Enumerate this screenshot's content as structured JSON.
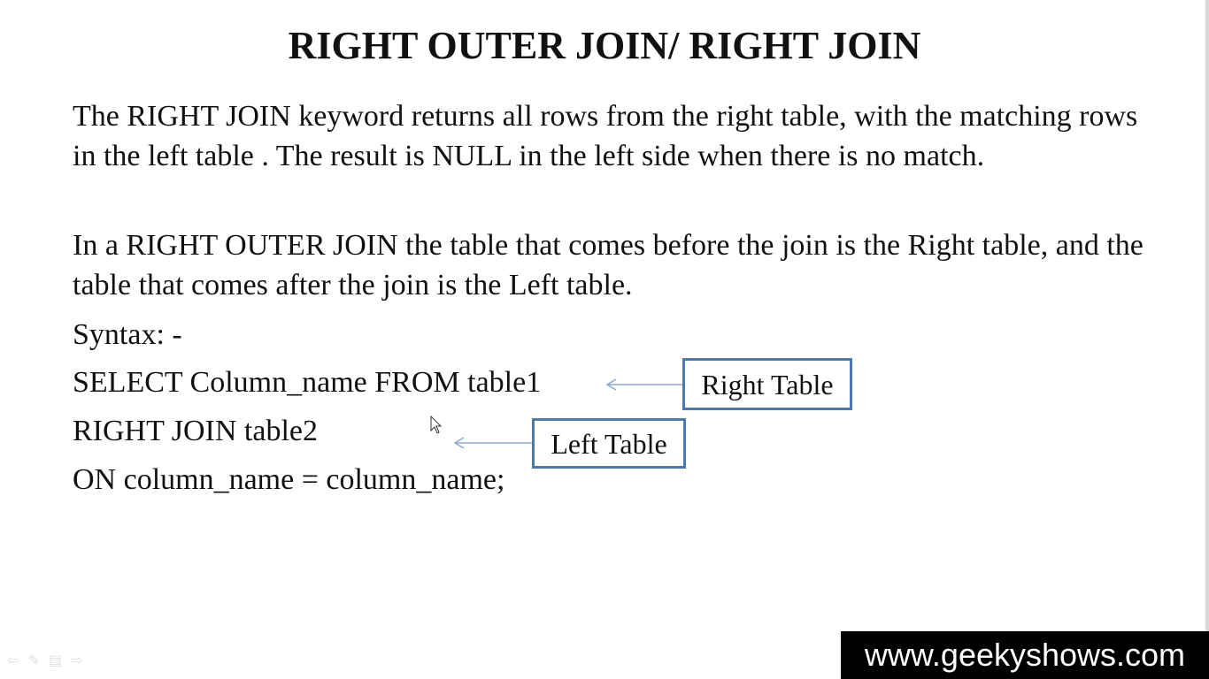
{
  "slide": {
    "title": "RIGHT OUTER JOIN/ RIGHT JOIN",
    "paragraph1": "The RIGHT JOIN keyword returns all rows from the right table, with the matching rows in the left table . The result is NULL in the left side when there is no match.",
    "paragraph2": "In a RIGHT OUTER JOIN the table that comes before the join is the Right table, and the table that comes after the join is the Left table.",
    "syntax_label": "Syntax: -",
    "code_lines": [
      "SELECT Column_name FROM table1",
      "RIGHT JOIN table2",
      "ON column_name = column_name;"
    ],
    "annotations": {
      "right_table": "Right Table",
      "left_table": "Left Table"
    }
  },
  "player": {
    "nav_icons": [
      "previous-icon",
      "pen-icon",
      "menu-icon",
      "next-icon"
    ]
  },
  "watermark": {
    "text": "www.geekyshows.com"
  },
  "colors": {
    "annotation_border": "#4a78b5",
    "arrow": "#8fa8cc",
    "watermark_bg": "#000000",
    "watermark_text": "#ffffff"
  }
}
